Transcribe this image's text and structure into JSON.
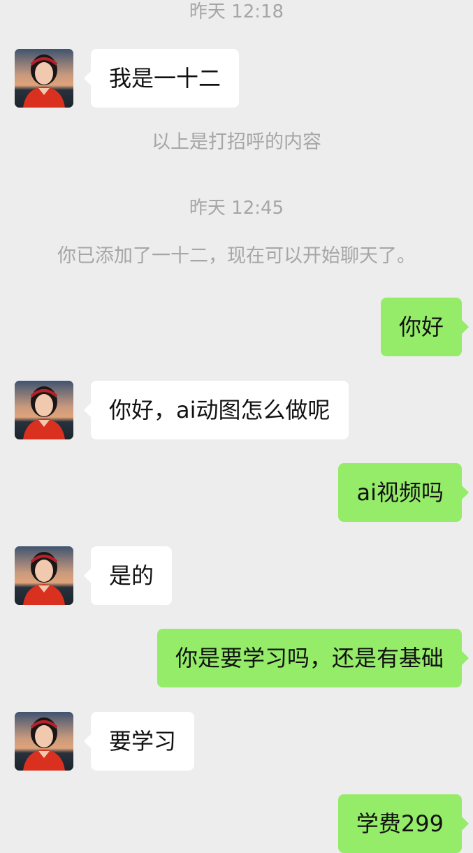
{
  "chat": {
    "stamps": [
      "昨天 12:18",
      "昨天 12:45"
    ],
    "system_notes": [
      "以上是打招呼的内容",
      "你已添加了一十二，现在可以开始聊天了。"
    ],
    "messages": [
      {
        "from": "contact",
        "text": "我是一十二"
      },
      {
        "from": "me",
        "text": "你好"
      },
      {
        "from": "contact",
        "text": "你好，ai动图怎么做呢"
      },
      {
        "from": "me",
        "text": "ai视频吗"
      },
      {
        "from": "contact",
        "text": "是的"
      },
      {
        "from": "me",
        "text": "你是要学习吗，还是有基础"
      },
      {
        "from": "contact",
        "text": "要学习"
      },
      {
        "from": "me",
        "text": "学费299"
      }
    ]
  },
  "colors": {
    "background": "#ededed",
    "incoming_bubble": "#ffffff",
    "outgoing_bubble": "#95ec69",
    "meta_text": "#a6a6a6"
  },
  "icons": {
    "contact_avatar": "contact-avatar-photo"
  }
}
